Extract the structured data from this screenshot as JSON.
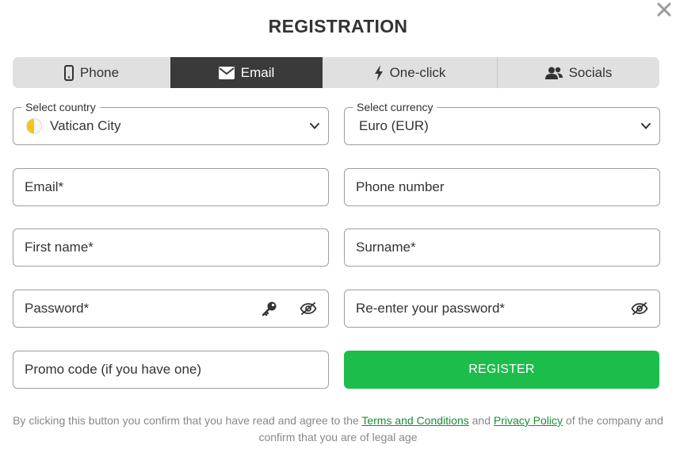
{
  "dialog": {
    "title": "REGISTRATION",
    "close_icon": "close-icon"
  },
  "tabs": [
    {
      "label": "Phone",
      "icon": "phone-icon",
      "active": false
    },
    {
      "label": "Email",
      "icon": "envelope-icon",
      "active": true
    },
    {
      "label": "One-click",
      "icon": "lightning-icon",
      "active": false
    },
    {
      "label": "Socials",
      "icon": "users-icon",
      "active": false
    }
  ],
  "form": {
    "country": {
      "legend": "Select country",
      "value": "Vatican City",
      "flag_icon": "vatican-flag-icon"
    },
    "currency": {
      "legend": "Select currency",
      "value": "Euro (EUR)"
    },
    "email": {
      "placeholder": "Email*"
    },
    "phone": {
      "placeholder": "Phone number"
    },
    "first_name": {
      "placeholder": "First name*"
    },
    "surname": {
      "placeholder": "Surname*"
    },
    "password": {
      "placeholder": "Password*"
    },
    "password_confirm": {
      "placeholder": "Re-enter your password*"
    },
    "promo": {
      "placeholder": "Promo code (if you have one)"
    },
    "register_label": "REGISTER"
  },
  "legal": {
    "prefix": "By clicking this button you confirm that you have read and agree to the",
    "terms_link": "Terms and Conditions",
    "and": "and",
    "privacy_link": "Privacy Policy",
    "suffix": "of the company and confirm that you are of legal age"
  },
  "colors": {
    "accent": "#1dbd4b",
    "tab_active_bg": "#3a3a3a",
    "tab_bg": "#e0e0e0",
    "link": "#1a8c39"
  }
}
